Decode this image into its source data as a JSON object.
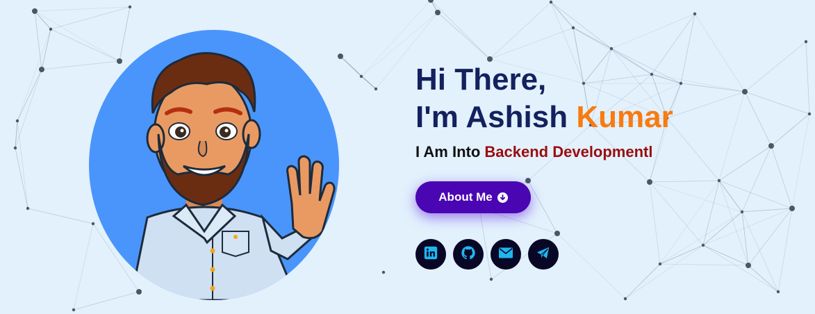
{
  "hero": {
    "greeting_line1": "Hi There,",
    "greeting_prefix": "I'm Ashish ",
    "greeting_name_accent": "Kumar",
    "tagline_prefix": "I Am Into ",
    "tagline_accent": "Backend Developmentl",
    "about_button_label": "About Me"
  },
  "socials": [
    {
      "name": "linkedin-icon"
    },
    {
      "name": "github-icon"
    },
    {
      "name": "mail-icon"
    },
    {
      "name": "telegram-icon"
    }
  ],
  "colors": {
    "background": "#e3f1fd",
    "heading": "#14215e",
    "name_accent": "#f87b10",
    "tagline_accent": "#9a0d0d",
    "button": "#4a06b2",
    "social_bg": "#080826",
    "social_icon": "#1fb6f0",
    "avatar_bg": "#4a95fb"
  }
}
